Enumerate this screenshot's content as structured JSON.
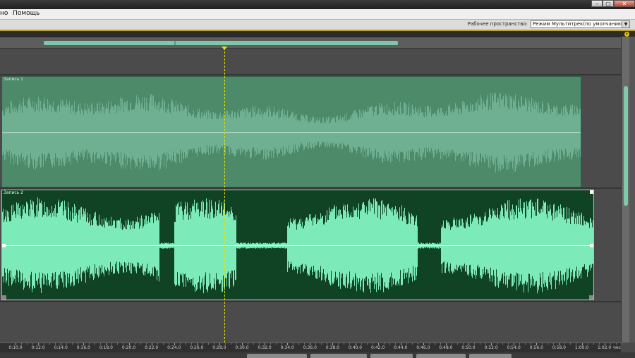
{
  "menu": {
    "items": [
      "но",
      "Помощь"
    ]
  },
  "window": {
    "buttons": [
      "–",
      "□",
      "✕"
    ]
  },
  "workspace": {
    "label": "Рабочее пространство:",
    "value": "Режим Мультитрек(по умолчанию)",
    "arrow": "▼"
  },
  "panel": {
    "menu_icon": "▸"
  },
  "tracks": [
    {
      "name": "Запись 1",
      "color": "#4d8a6a",
      "wave_color": "#6fb093"
    },
    {
      "name": "Запись 2",
      "color": "#0f4324",
      "wave_color": "#7deab9"
    }
  ],
  "timeline": {
    "playhead_time": "0:29.0",
    "ticks": [
      "0:10.0",
      "0:12.0",
      "0:14.0",
      "0:16.0",
      "0:18.0",
      "0:20.0",
      "0:22.0",
      "0:24.0",
      "0:26.0",
      "0:28.0",
      "0:30.0",
      "0:32.0",
      "0:34.0",
      "0:36.0",
      "0:38.0",
      "0:40.0",
      "0:42.0",
      "0:44.0",
      "0:46.0",
      "0:48.0",
      "0:50.0",
      "0:52.0",
      "0:54.0",
      "0:56.0",
      "0:58.0",
      "1:00.0",
      "1:02.0"
    ],
    "unit": "чмс"
  },
  "colors": {
    "accent": "#e8e000",
    "overview_range": "#7ec8aa"
  }
}
